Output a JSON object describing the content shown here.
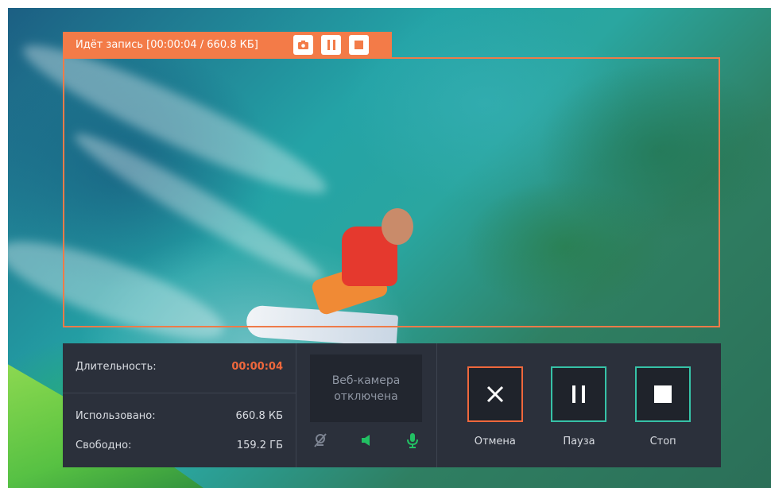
{
  "recording_bar": {
    "status": "Идёт запись [00:00:04 / 660.8 КБ]",
    "screenshot_icon": "camera-icon",
    "pause_icon": "pause-icon",
    "stop_icon": "stop-icon"
  },
  "stats": {
    "duration_label": "Длительность:",
    "duration_value": "00:00:04",
    "used_label": "Использовано:",
    "used_value": "660.8 КБ",
    "free_label": "Свободно:",
    "free_value": "159.2 ГБ"
  },
  "webcam": {
    "status": "Веб-камера отключена",
    "icons": [
      "webcam-off-icon",
      "speaker-icon",
      "microphone-icon"
    ]
  },
  "actions": {
    "cancel_label": "Отмена",
    "pause_label": "Пауза",
    "stop_label": "Стоп"
  },
  "colors": {
    "accent_orange": "#f37b48",
    "accent_teal": "#36c2a7",
    "panel_bg": "#2b303b",
    "icon_green": "#22c063"
  }
}
